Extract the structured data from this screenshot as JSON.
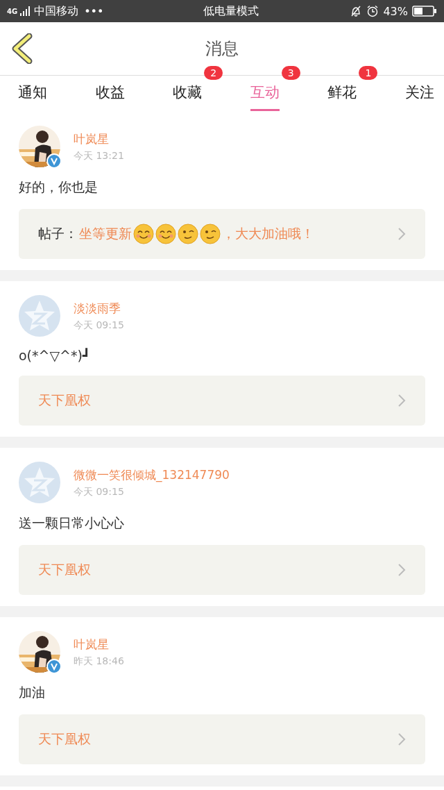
{
  "status_bar": {
    "network": "4G",
    "carrier": "中国移动",
    "dots": "•••",
    "mode": "低电量模式",
    "battery": "43%"
  },
  "header": {
    "title": "消息"
  },
  "tabs": [
    {
      "label": "通知",
      "selected": false
    },
    {
      "label": "收益",
      "selected": false
    },
    {
      "label": "收藏",
      "selected": false,
      "badge": "2"
    },
    {
      "label": "互动",
      "selected": true,
      "badge": "3"
    },
    {
      "label": "鲜花",
      "selected": false,
      "badge": "1"
    },
    {
      "label": "关注",
      "selected": false
    }
  ],
  "messages": [
    {
      "verified": true,
      "name": "叶岚星",
      "time": "今天 13:21",
      "text": "好的，你也是",
      "card": {
        "label": "帖子：",
        "parts": [
          {
            "kind": "text",
            "text": "坐等更新"
          },
          {
            "kind": "smile"
          },
          {
            "kind": "smile"
          },
          {
            "kind": "wink"
          },
          {
            "kind": "wink"
          },
          {
            "kind": "text",
            "text": "，大大加油哦！"
          }
        ]
      }
    },
    {
      "avatar": {
        "kind": "default"
      },
      "verified": false,
      "name": "淡淡雨季",
      "time": "今天 09:15",
      "text": "o(*^▽^*)┛",
      "card": {
        "parts": [
          {
            "kind": "text",
            "text": "天下凰权"
          }
        ]
      }
    },
    {
      "avatar": {
        "kind": "default"
      },
      "verified": false,
      "name": "微微一笑很倾城_132147790",
      "time": "今天 09:15",
      "text": "送一颗日常小心心",
      "card": {
        "parts": [
          {
            "kind": "text",
            "text": "天下凰权"
          }
        ]
      }
    },
    {
      "verified": true,
      "name": "叶岚星",
      "time": "昨天 18:46",
      "text": "加油",
      "card": {
        "parts": [
          {
            "kind": "text",
            "text": "天下凰权"
          }
        ]
      }
    }
  ]
}
